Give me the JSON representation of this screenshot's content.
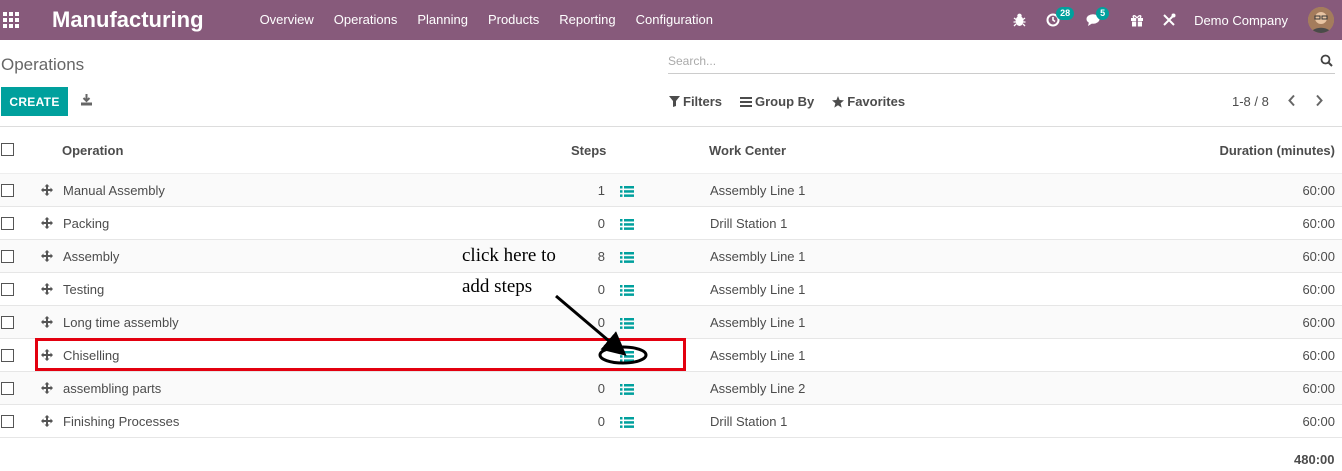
{
  "navbar": {
    "brand": "Manufacturing",
    "menu": [
      {
        "label": "Overview"
      },
      {
        "label": "Operations"
      },
      {
        "label": "Planning"
      },
      {
        "label": "Products"
      },
      {
        "label": "Reporting"
      },
      {
        "label": "Configuration"
      }
    ],
    "activity_count": "28",
    "messages_count": "5",
    "company": "Demo Company",
    "accent_color": "#875a7b",
    "badge_color": "#00a09d"
  },
  "control_panel": {
    "breadcrumb": "Operations",
    "search_placeholder": "Search...",
    "create_label": "CREATE",
    "filters_label": "Filters",
    "group_by_label": "Group By",
    "favorites_label": "Favorites",
    "pager": "1-8 / 8"
  },
  "table": {
    "columns": {
      "operation": "Operation",
      "steps": "Steps",
      "work_center": "Work Center",
      "duration": "Duration (minutes)"
    },
    "rows": [
      {
        "operation": "Manual Assembly",
        "steps": "1",
        "work_center": "Assembly Line 1",
        "duration": "60:00"
      },
      {
        "operation": "Packing",
        "steps": "0",
        "work_center": "Drill Station 1",
        "duration": "60:00"
      },
      {
        "operation": "Assembly",
        "steps": "8",
        "work_center": "Assembly Line 1",
        "duration": "60:00"
      },
      {
        "operation": "Testing",
        "steps": "0",
        "work_center": "Assembly Line 1",
        "duration": "60:00"
      },
      {
        "operation": "Long time assembly",
        "steps": "0",
        "work_center": "Assembly Line 1",
        "duration": "60:00"
      },
      {
        "operation": "Chiselling",
        "steps": "",
        "work_center": "Assembly Line 1",
        "duration": "60:00"
      },
      {
        "operation": "assembling parts",
        "steps": "0",
        "work_center": "Assembly Line 2",
        "duration": "60:00"
      },
      {
        "operation": "Finishing Processes",
        "steps": "0",
        "work_center": "Drill Station 1",
        "duration": "60:00"
      }
    ],
    "total_duration": "480:00"
  },
  "annotation": {
    "line1": "click here to",
    "line2": "add steps",
    "highlight_color": "#e3000f"
  }
}
